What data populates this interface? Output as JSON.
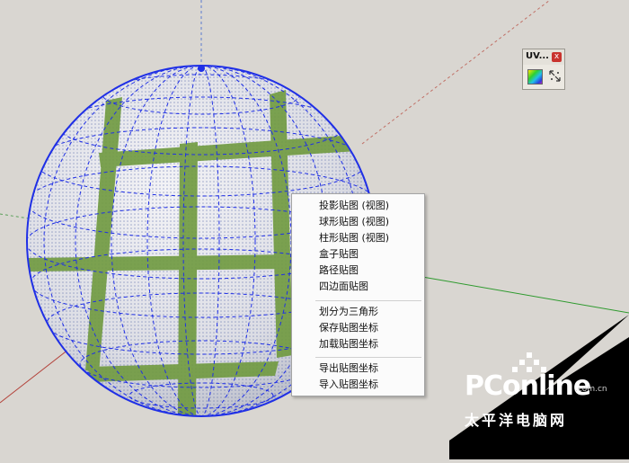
{
  "toolbar": {
    "title": "UV...",
    "close_label": "x",
    "buttons": [
      {
        "icon": "uv-color-icon"
      },
      {
        "icon": "uv-arrows-icon"
      }
    ]
  },
  "context_menu": {
    "groups": [
      [
        "投影贴图 (视图)",
        "球形贴图 (视图)",
        "柱形贴图 (视图)",
        "盒子贴图",
        "路径贴图",
        "四边面贴图"
      ],
      [
        "划分为三角形",
        "保存贴图坐标",
        "加载贴图坐标"
      ],
      [
        "导出贴图坐标",
        "导入贴图坐标"
      ]
    ]
  },
  "watermark": {
    "brand": "PConline",
    "domain": ".com.cn",
    "subtitle": "太平洋电脑网"
  },
  "colors": {
    "viewport_bg": "#d9d6d1",
    "wire": "#1f2fe6",
    "grass": "#6f9a3f",
    "axis_red": "#b3423a",
    "axis_green": "#2e9a2e"
  }
}
